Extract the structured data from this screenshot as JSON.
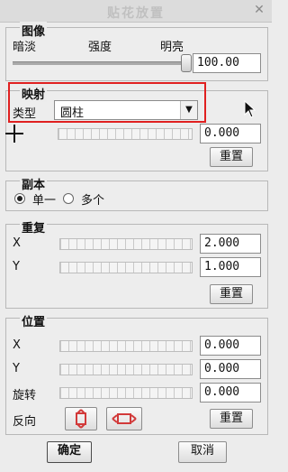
{
  "window": {
    "title": "贴花放置",
    "close_glyph": "✕"
  },
  "image_group": {
    "title": "图像",
    "dim_label": "暗淡",
    "intensity_label": "强度",
    "bright_label": "明亮",
    "value": "100.00",
    "slider_fraction": 1.0
  },
  "mapping_group": {
    "title": "映射",
    "type_label": "类型",
    "type_value": "圆柱",
    "param_value": "0.000",
    "reset_label": "重置"
  },
  "copy_group": {
    "title": "副本",
    "single_label": "单一",
    "multiple_label": "多个",
    "selected": "single"
  },
  "repeat_group": {
    "title": "重复",
    "x_label": "X",
    "y_label": "Y",
    "x_value": "2.000",
    "y_value": "1.000",
    "reset_label": "重置"
  },
  "position_group": {
    "title": "位置",
    "x_label": "X",
    "y_label": "Y",
    "rotate_label": "旋转",
    "x_value": "0.000",
    "y_value": "0.000",
    "rotate_value": "0.000",
    "flip_label": "反向",
    "reset_label": "重置"
  },
  "footer": {
    "ok_label": "确定",
    "cancel_label": "取消"
  },
  "colors": {
    "highlight_box": "#e02020",
    "flip_icon": "#d23a3a"
  }
}
